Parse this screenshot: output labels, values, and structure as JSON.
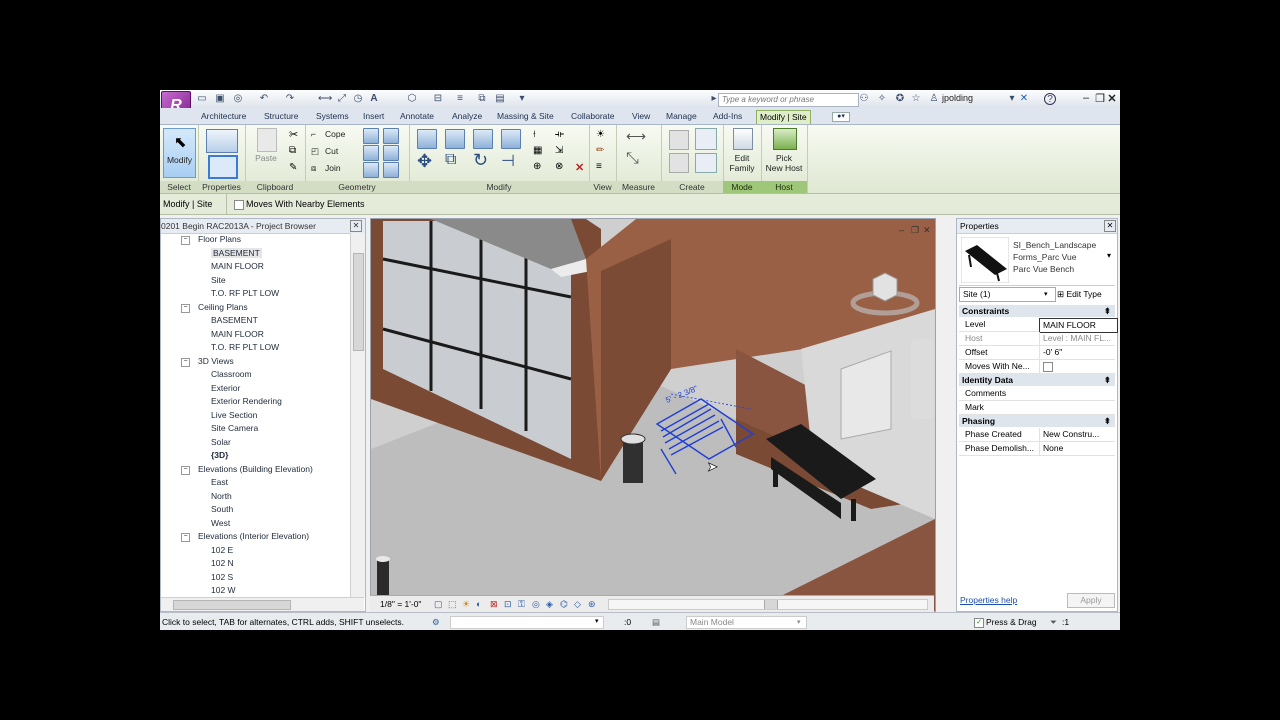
{
  "title_bar": {
    "search_placeholder": "Type a keyword or phrase",
    "username": "jpolding",
    "icons": [
      "open-icon",
      "save-icon",
      "sync-icon",
      "undo-icon",
      "redo-icon",
      "print-icon",
      "measure-icon",
      "dimension-icon",
      "tag-icon",
      "text-icon",
      "3d-view-icon",
      "section-icon",
      "thin-lines-icon",
      "close-views-icon",
      "switch-windows-icon",
      "customize-icon"
    ]
  },
  "ribbon": {
    "tabs": [
      "Architecture",
      "Structure",
      "Systems",
      "Insert",
      "Annotate",
      "Analyze",
      "Massing & Site",
      "Collaborate",
      "View",
      "Manage",
      "Add-Ins",
      "Modify | Site"
    ],
    "active_tab": "Modify | Site",
    "panels": {
      "select": {
        "title": "Select",
        "modify_label": "Modify"
      },
      "properties": {
        "title": "Properties"
      },
      "clipboard": {
        "title": "Clipboard",
        "paste_label": "Paste"
      },
      "geometry": {
        "title": "Geometry",
        "cope": "Cope",
        "cut": "Cut",
        "join": "Join"
      },
      "modify": {
        "title": "Modify"
      },
      "view": {
        "title": "View"
      },
      "measure": {
        "title": "Measure"
      },
      "create": {
        "title": "Create"
      },
      "mode": {
        "title": "Mode",
        "edit_family_1": "Edit",
        "edit_family_2": "Family"
      },
      "host": {
        "title": "Host",
        "pick_host_1": "Pick",
        "pick_host_2": "New Host"
      }
    }
  },
  "options_bar": {
    "context": "Modify | Site",
    "moves_with_nearby": "Moves With Nearby Elements"
  },
  "project_browser": {
    "title": "0201 Begin RAC2013A - Project Browser",
    "rows": [
      {
        "text": "Floor Plans",
        "level": 1,
        "expander": "−"
      },
      {
        "text": "BASEMENT",
        "level": 2,
        "selected": true
      },
      {
        "text": "MAIN FLOOR",
        "level": 2
      },
      {
        "text": "Site",
        "level": 2
      },
      {
        "text": "T.O. RF PLT LOW",
        "level": 2
      },
      {
        "text": "Ceiling Plans",
        "level": 1,
        "expander": "−"
      },
      {
        "text": "BASEMENT",
        "level": 2
      },
      {
        "text": "MAIN FLOOR",
        "level": 2
      },
      {
        "text": "T.O. RF PLT LOW",
        "level": 2
      },
      {
        "text": "3D Views",
        "level": 1,
        "expander": "−"
      },
      {
        "text": "Classroom",
        "level": 2
      },
      {
        "text": "Exterior",
        "level": 2
      },
      {
        "text": "Exterior Rendering",
        "level": 2
      },
      {
        "text": "Live Section",
        "level": 2
      },
      {
        "text": "Site Camera",
        "level": 2
      },
      {
        "text": "Solar",
        "level": 2
      },
      {
        "text": "{3D}",
        "level": 2,
        "bold": true
      },
      {
        "text": "Elevations (Building Elevation)",
        "level": 1,
        "expander": "−"
      },
      {
        "text": "East",
        "level": 2
      },
      {
        "text": "North",
        "level": 2
      },
      {
        "text": "South",
        "level": 2
      },
      {
        "text": "West",
        "level": 2
      },
      {
        "text": "Elevations (Interior Elevation)",
        "level": 1,
        "expander": "−"
      },
      {
        "text": "102 E",
        "level": 2
      },
      {
        "text": "102 N",
        "level": 2
      },
      {
        "text": "102 S",
        "level": 2
      },
      {
        "text": "102 W",
        "level": 2
      }
    ]
  },
  "viewport": {
    "scale": "1/8\" = 1'-0\"",
    "temp_dimension": "5' - 2 3/8\""
  },
  "properties": {
    "title": "Properties",
    "type_line1": "SI_Bench_Landscape",
    "type_line2": "Forms_Parc Vue",
    "type_line3": "Parc Vue Bench",
    "selector": "Site (1)",
    "edit_type": "Edit Type",
    "groups": [
      {
        "name": "Constraints",
        "rows": [
          {
            "k": "Level",
            "v": "MAIN FLOOR"
          },
          {
            "k": "Host",
            "v": "Level : MAIN FL..."
          },
          {
            "k": "Offset",
            "v": "-0' 6\""
          },
          {
            "k": "Moves With Ne...",
            "v": ""
          }
        ]
      },
      {
        "name": "Identity Data",
        "rows": [
          {
            "k": "Comments",
            "v": ""
          },
          {
            "k": "Mark",
            "v": ""
          }
        ]
      },
      {
        "name": "Phasing",
        "rows": [
          {
            "k": "Phase Created",
            "v": "New Constru..."
          },
          {
            "k": "Phase Demolish...",
            "v": "None"
          }
        ]
      }
    ],
    "help_link": "Properties help",
    "apply": "Apply"
  },
  "status_bar": {
    "hint": "Click to select, TAB for alternates, CTRL adds, SHIFT unselects.",
    "count": ":0",
    "model": "Main Model",
    "press_drag": "Press & Drag",
    "filter_count": ":1"
  },
  "colors": {
    "ribbon_active": "#9fc77a",
    "wall_brick": "#7a4a35",
    "selection_blue": "#1f3fd6"
  }
}
